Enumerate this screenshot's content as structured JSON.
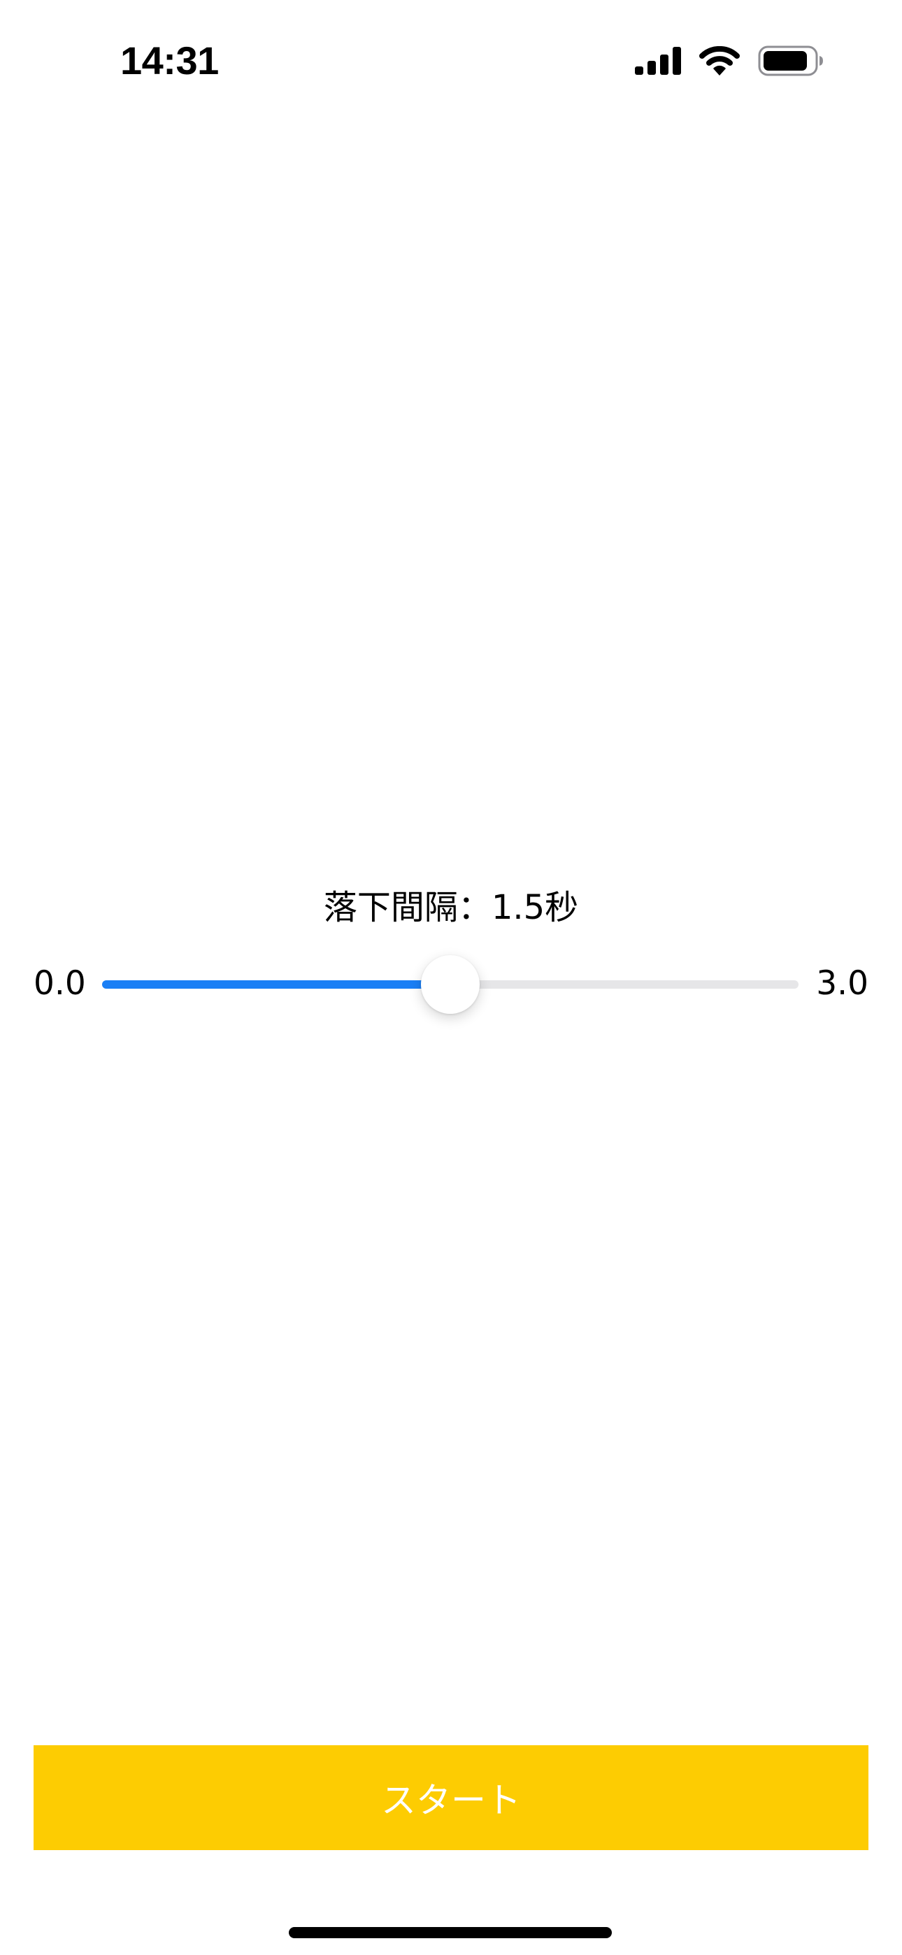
{
  "status_bar": {
    "time": "14:31",
    "icons": [
      "cellular-signal-icon",
      "wifi-icon",
      "battery-icon"
    ]
  },
  "slider": {
    "label": "落下間隔：1.5秒",
    "min_label": "0.0",
    "max_label": "3.0",
    "min": 0.0,
    "max": 3.0,
    "value": 1.5
  },
  "start_button": {
    "label": "スタート"
  },
  "colors": {
    "slider_fill": "#1a7ff5",
    "slider_track": "#e6e6e8",
    "start_button_bg": "#fdcc02",
    "start_button_text": "#ffffff"
  }
}
